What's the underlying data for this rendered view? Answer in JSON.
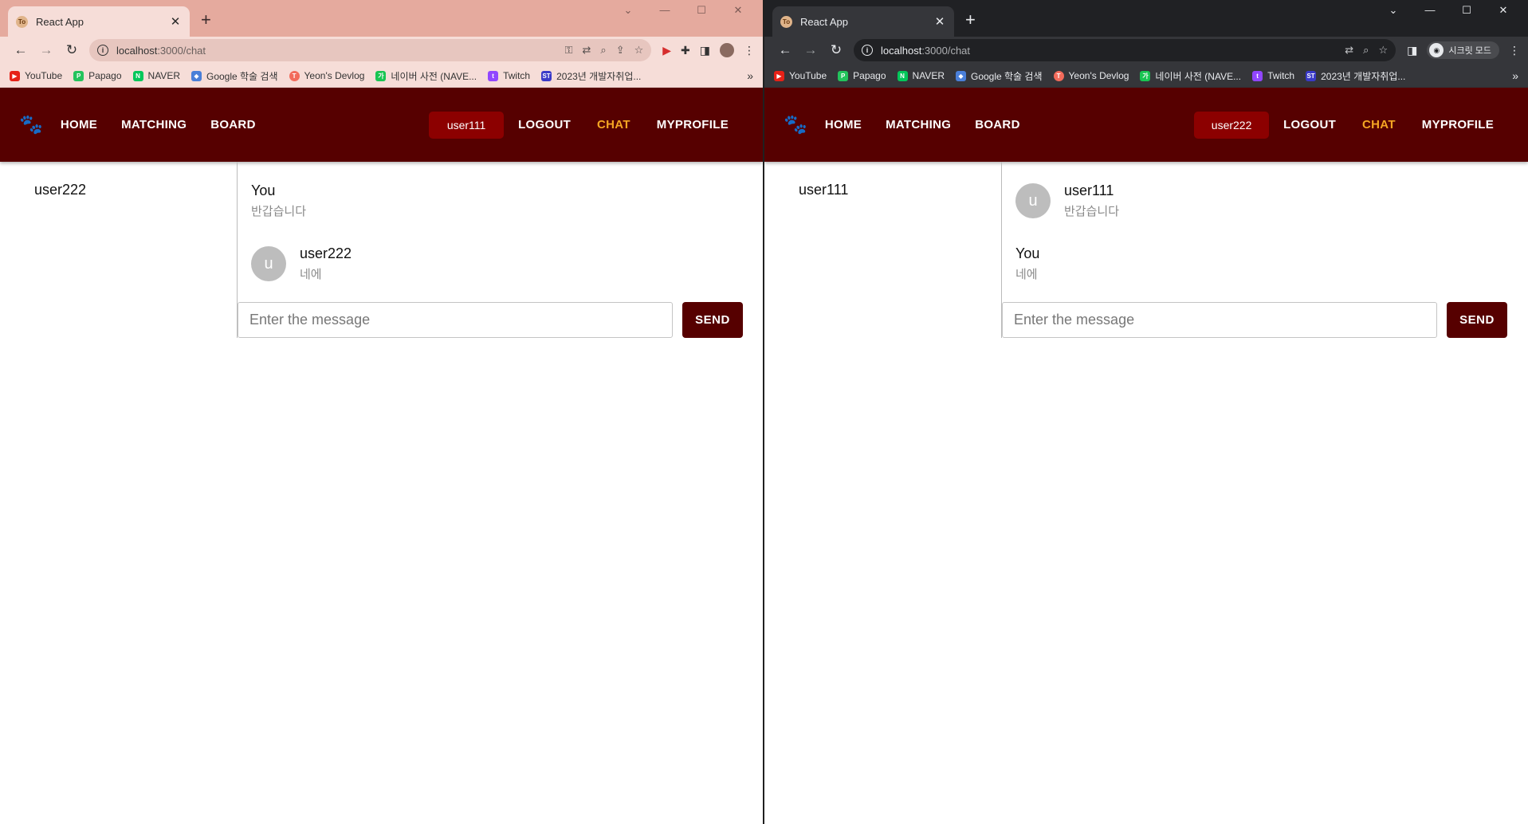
{
  "left": {
    "tab_title": "React App",
    "favicon_text": "To",
    "url_host": "localhost",
    "url_path": ":3000/chat",
    "bookmarks": [
      "YouTube",
      "Papago",
      "NAVER",
      "Google 학술 검색",
      "Yeon's Devlog",
      "네이버 사전 (NAVE...",
      "Twitch",
      "2023년 개발자취업..."
    ],
    "nav": {
      "home": "HOME",
      "matching": "MATCHING",
      "board": "BOARD",
      "user": "user111",
      "logout": "LOGOUT",
      "chat": "CHAT",
      "myprofile": "MYPROFILE"
    },
    "contacts": [
      "user222"
    ],
    "messages": [
      {
        "name": "You",
        "text": "반갑습니다",
        "avatar": ""
      },
      {
        "name": "user222",
        "text": "네에",
        "avatar": "u"
      }
    ],
    "input_placeholder": "Enter the message",
    "send_label": "SEND"
  },
  "right": {
    "tab_title": "React App",
    "favicon_text": "To",
    "url_host": "localhost",
    "url_path": ":3000/chat",
    "incognito_label": "시크릿 모드",
    "bookmarks": [
      "YouTube",
      "Papago",
      "NAVER",
      "Google 학술 검색",
      "Yeon's Devlog",
      "네이버 사전 (NAVE...",
      "Twitch",
      "2023년 개발자취업..."
    ],
    "nav": {
      "home": "HOME",
      "matching": "MATCHING",
      "board": "BOARD",
      "user": "user222",
      "logout": "LOGOUT",
      "chat": "CHAT",
      "myprofile": "MYPROFILE"
    },
    "contacts": [
      "user111"
    ],
    "messages": [
      {
        "name": "user111",
        "text": "반갑습니다",
        "avatar": "u"
      },
      {
        "name": "You",
        "text": "네에",
        "avatar": ""
      }
    ],
    "input_placeholder": "Enter the message",
    "send_label": "SEND"
  },
  "colors": {
    "navbar": "#560000",
    "active_nav": "#f5a623",
    "user_button": "#8c0000",
    "send_button": "#560000"
  },
  "icons": {
    "back": "arrow-left",
    "forward": "arrow-right",
    "reload": "reload",
    "paw": "paw-logo"
  }
}
